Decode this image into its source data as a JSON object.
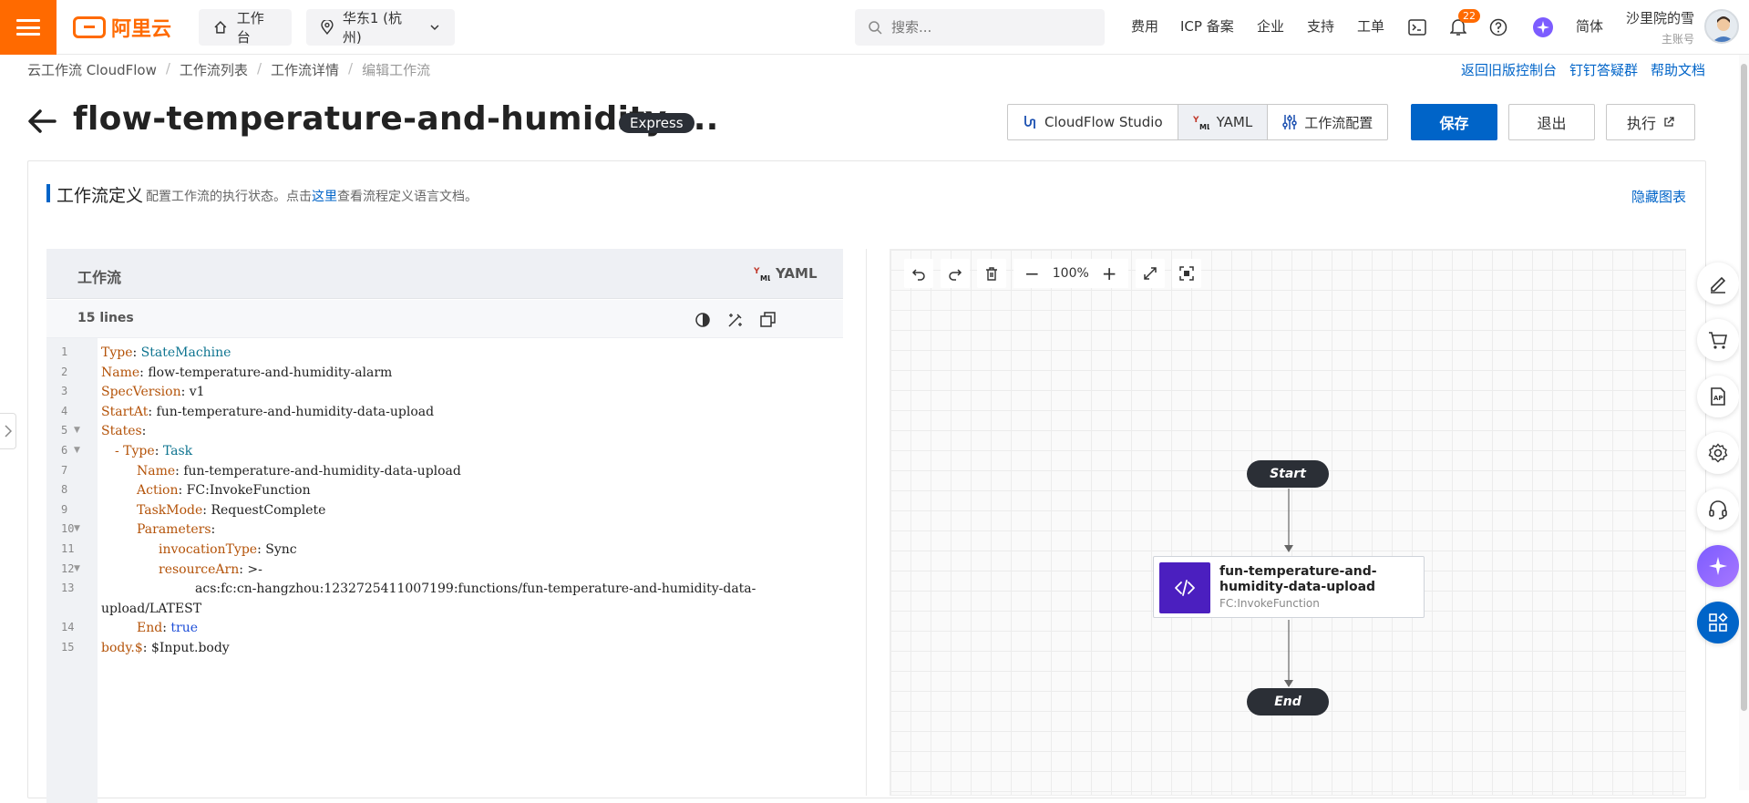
{
  "topbar": {
    "logo": "阿里云",
    "workbench": "工作台",
    "region": "华东1 (杭州)",
    "search_placeholder": "搜索...",
    "nav": [
      "费用",
      "ICP 备案",
      "企业",
      "支持",
      "工单"
    ],
    "notifications": "22",
    "lang": "简体",
    "user_name": "沙里院的雪",
    "user_role": "主账号"
  },
  "breadcrumb": [
    "云工作流 CloudFlow",
    "工作流列表",
    "工作流详情",
    "编辑工作流"
  ],
  "top_links": [
    "返回旧版控制台",
    "钉钉答疑群",
    "帮助文档"
  ],
  "header": {
    "title": "flow-temperature-and-humidity-...",
    "badge": "Express",
    "seg_studio": "CloudFlow Studio",
    "seg_yaml": "YAML",
    "seg_config": "工作流配置",
    "save": "保存",
    "exit": "退出",
    "run": "执行"
  },
  "section": {
    "title": "工作流定义",
    "desc_before": "配置工作流的执行状态。点击",
    "desc_link": "这里",
    "desc_after": "查看流程定义语言文档。",
    "hide": "隐藏图表"
  },
  "editor": {
    "title": "工作流",
    "format": "YAML",
    "lines_label": "15 lines",
    "line_numbers": [
      "1",
      "2",
      "3",
      "4",
      "5",
      "6",
      "7",
      "8",
      "9",
      "10",
      "11",
      "12",
      "13",
      "",
      "14",
      "15"
    ],
    "code": [
      {
        "k": "Type",
        "v": "StateMachine",
        "c": "v"
      },
      {
        "k": "Name",
        "v": "flow-temperature-and-humidity-alarm",
        "c": ""
      },
      {
        "k": "SpecVersion",
        "v": "v1",
        "c": ""
      },
      {
        "k": "StartAt",
        "v": "fun-temperature-and-humidity-data-upload",
        "c": ""
      },
      {
        "k": "States",
        "v": "",
        "c": ""
      },
      {
        "k": "- Type",
        "v": "Task",
        "c": "v"
      },
      {
        "k": "Name",
        "v": "fun-temperature-and-humidity-data-upload",
        "c": ""
      },
      {
        "k": "Action",
        "v": "FC:InvokeFunction",
        "c": ""
      },
      {
        "k": "TaskMode",
        "v": "RequestComplete",
        "c": ""
      },
      {
        "k": "Parameters",
        "v": "",
        "c": ""
      },
      {
        "k": "invocationType",
        "v": "Sync",
        "c": ""
      },
      {
        "k": "resourceArn",
        "v": ">-",
        "c": ""
      },
      {
        "k": "",
        "v": "acs:fc:cn-hangzhou:1232725411007199:functions/fun-temperature-and-humidity-data-",
        "c": ""
      },
      {
        "k": "",
        "v": "upload/LATEST",
        "c": ""
      },
      {
        "k": "End",
        "v": "true",
        "c": "t"
      },
      {
        "k": "body.$",
        "v": "$Input.body",
        "c": ""
      }
    ]
  },
  "canvas": {
    "zoom": "100%",
    "start": "Start",
    "end": "End",
    "task_name": "fun-temperature-and-humidity-data-upload",
    "task_type": "FC:InvokeFunction"
  }
}
